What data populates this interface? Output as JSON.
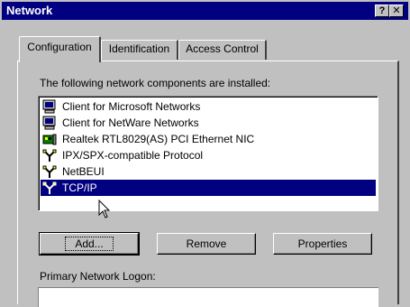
{
  "window": {
    "title": "Network"
  },
  "titlebar_buttons": {
    "help": "?",
    "close": "✕"
  },
  "tabs": [
    {
      "label": "Configuration",
      "active": true
    },
    {
      "label": "Identification",
      "active": false
    },
    {
      "label": "Access Control",
      "active": false
    }
  ],
  "components": {
    "label": "The following network components are installed:",
    "items": [
      {
        "label": "Client for Microsoft Networks",
        "icon": "client-icon",
        "selected": false
      },
      {
        "label": "Client for NetWare Networks",
        "icon": "client-icon",
        "selected": false
      },
      {
        "label": "Realtek RTL8029(AS) PCI Ethernet NIC",
        "icon": "network-adapter-icon",
        "selected": false
      },
      {
        "label": "IPX/SPX-compatible Protocol",
        "icon": "protocol-icon",
        "selected": false
      },
      {
        "label": "NetBEUI",
        "icon": "protocol-icon",
        "selected": false
      },
      {
        "label": "TCP/IP",
        "icon": "protocol-icon",
        "selected": true
      }
    ]
  },
  "buttons": {
    "add": "Add...",
    "remove": "Remove",
    "properties": "Properties"
  },
  "logon": {
    "label": "Primary Network Logon:"
  },
  "colors": {
    "titlebar": "#000080",
    "selection": "#000080",
    "face": "#c0c0c0"
  }
}
